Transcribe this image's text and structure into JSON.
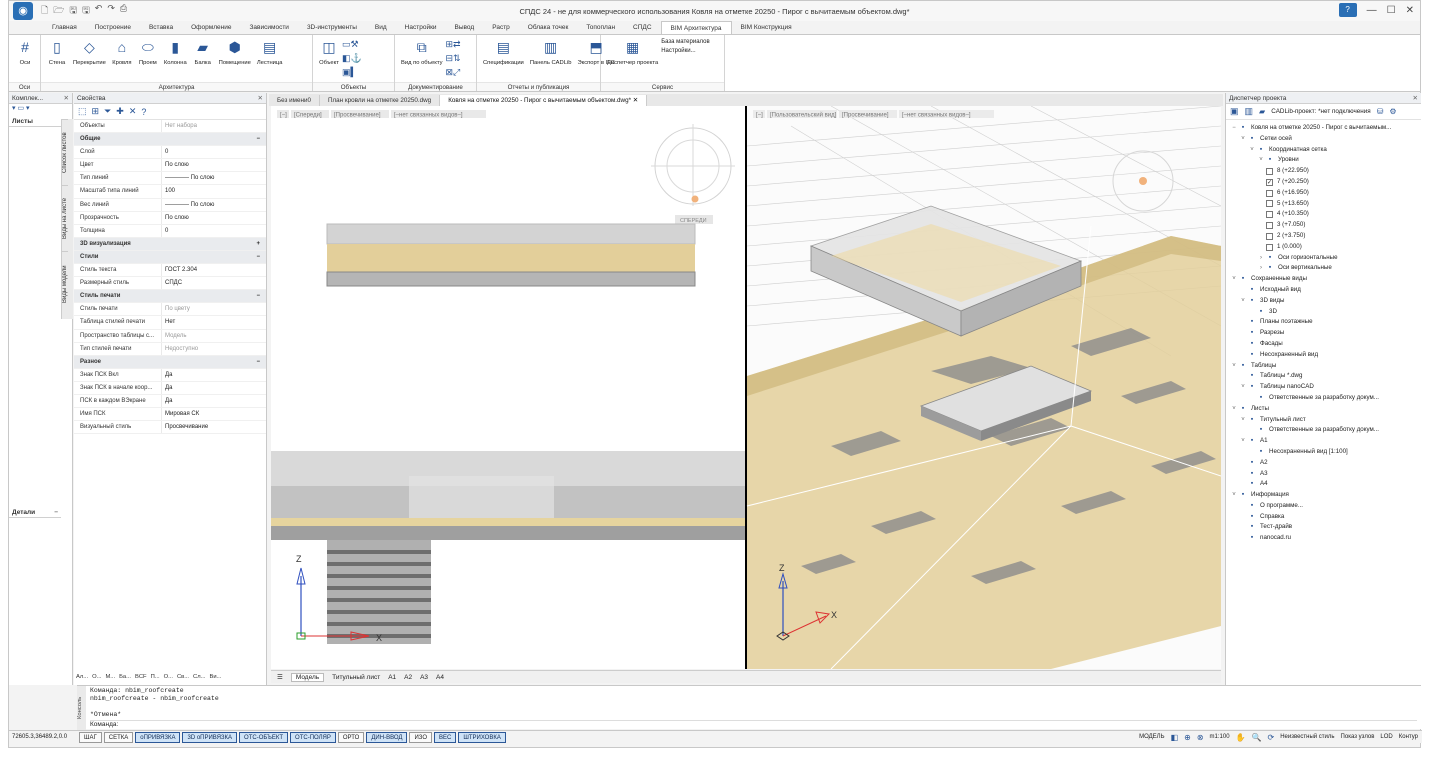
{
  "window": {
    "title": "СПДС 24 - не для коммерческого использования Ковля на отметке 20250 - Пирог с вычитаемым объектом.dwg*",
    "help": "?",
    "controls": [
      "—",
      "☐",
      "✕"
    ]
  },
  "ribbon_tabs": [
    "Главная",
    "Построение",
    "Вставка",
    "Оформление",
    "Зависимости",
    "3D-инструменты",
    "Вид",
    "Настройки",
    "Вывод",
    "Растр",
    "Облака точек",
    "Топоплан",
    "СПДС",
    "BIM Архитектура",
    "BIM Конструкция"
  ],
  "active_tab": "BIM Архитектура",
  "ribbon": {
    "groups": [
      {
        "label": "Оси",
        "buttons": [
          {
            "label": "Оси",
            "icon": "grid-axes-icon"
          }
        ]
      },
      {
        "label": "Архитектура",
        "buttons": [
          {
            "label": "Стена",
            "icon": "wall-icon"
          },
          {
            "label": "Перекрытие",
            "icon": "slab-icon"
          },
          {
            "label": "Кровля",
            "icon": "roof-icon"
          },
          {
            "label": "Проем",
            "icon": "opening-icon"
          },
          {
            "label": "Колонна",
            "icon": "column-icon"
          },
          {
            "label": "Балка",
            "icon": "beam-icon"
          },
          {
            "label": "Помещение",
            "icon": "room-icon"
          },
          {
            "label": "Лестница",
            "icon": "stair-icon"
          }
        ]
      },
      {
        "label": "Объекты",
        "buttons": [
          {
            "label": "Объект",
            "icon": "object-icon"
          }
        ]
      },
      {
        "label": "Документирование",
        "buttons": [
          {
            "label": "Вид по объекту",
            "icon": "view-by-object-icon"
          }
        ]
      },
      {
        "label": "Отчеты и публикация",
        "buttons": [
          {
            "label": "Спецификации",
            "icon": "specification-icon"
          },
          {
            "label": "Панель CADLib",
            "icon": "cadlib-panel-icon"
          },
          {
            "label": "Экспорт в IFC",
            "icon": "ifc-export-icon"
          }
        ]
      },
      {
        "label": "Сервис",
        "buttons": [
          {
            "label": "Диспетчер проекта",
            "icon": "project-manager-icon"
          }
        ],
        "side": [
          "База материалов",
          "Настройки..."
        ]
      }
    ]
  },
  "left_panel": {
    "title": "Комплек...",
    "sheets_label": "Листы",
    "details_label": "Детали",
    "vertical_tabs": [
      "Список листов",
      "Виды на листе",
      "Виды модели"
    ]
  },
  "properties": {
    "title": "Свойства",
    "rows": [
      {
        "k": "Объекты",
        "v": "Нет набора",
        "dim": true
      },
      {
        "section": "Общие",
        "sign": "−"
      },
      {
        "k": "Слой",
        "v": "0"
      },
      {
        "k": "Цвет",
        "v": "По слою"
      },
      {
        "k": "Тип линий",
        "v": "———— По слою"
      },
      {
        "k": "Масштаб типа линий",
        "v": "100"
      },
      {
        "k": "Вес линий",
        "v": "———— По слою"
      },
      {
        "k": "Прозрачность",
        "v": "По слою"
      },
      {
        "k": "Толщина",
        "v": "0"
      },
      {
        "section": "3D визуализация",
        "sign": "+"
      },
      {
        "section": "Стили",
        "sign": "−"
      },
      {
        "k": "Стиль текста",
        "v": "ГОСТ 2.304"
      },
      {
        "k": "Размерный стиль",
        "v": "СПДС"
      },
      {
        "section": "Стиль печати",
        "sign": "−"
      },
      {
        "k": "Стиль печати",
        "v": "По цвету",
        "dim": true
      },
      {
        "k": "Таблица стилей печати",
        "v": "Нет"
      },
      {
        "k": "Пространство таблицы с...",
        "v": "Модель",
        "dim": true
      },
      {
        "k": "Тип стилей печати",
        "v": "Недоступно",
        "dim": true
      },
      {
        "section": "Разное",
        "sign": "−"
      },
      {
        "k": "Знак ПСК Вкл",
        "v": "Да"
      },
      {
        "k": "Знак ПСК в начале коор...",
        "v": "Да"
      },
      {
        "k": "ПСК в каждом ВЭкране",
        "v": "Да"
      },
      {
        "k": "Имя ПСК",
        "v": "Мировая СК"
      },
      {
        "k": "Визуальный стиль",
        "v": "Просвечивание"
      }
    ],
    "bottom_tabs": [
      "Ал...",
      "О...",
      "М...",
      "Ба...",
      "BCF",
      "П...",
      "О...",
      "Св...",
      "Сл...",
      "Ви..."
    ]
  },
  "doc_tabs": [
    "Без имени0",
    "План кровли на отметке 20250.dwg",
    "Ковля на отметке 20250 - Пирог с вычитаемым объектом.dwg*"
  ],
  "doc_tab_close": "✕",
  "viewport": {
    "left_labels": [
      "[−]",
      "[Спереди]",
      "[Просвечивание]",
      "[–нет связанных видов–]"
    ],
    "right_labels": [
      "[−]",
      "[Пользовательский вид]",
      "[Просвечивание]",
      "[–нет связанных видов–]"
    ],
    "front_label": "СПЕРЕДИ"
  },
  "layout_tabs": [
    "Модель",
    "Титульный лист",
    "A1",
    "A2",
    "A3",
    "A4"
  ],
  "active_layout": "Модель",
  "project_manager": {
    "title": "Диспетчер проекта",
    "project_label": "CADLib-проект: *нет подключения",
    "tree": [
      {
        "d": 0,
        "tw": "−",
        "icon": "drawing-icon",
        "label": "Ковля на отметке 20250 - Пирог с вычитаемым..."
      },
      {
        "d": 1,
        "tw": "˅",
        "icon": "grid-icon",
        "label": "Сетки осей"
      },
      {
        "d": 2,
        "tw": "˅",
        "icon": "grid-icon",
        "label": "Координатная сетка"
      },
      {
        "d": 3,
        "tw": "˅",
        "icon": "levels-icon",
        "label": "Уровни"
      },
      {
        "d": 4,
        "cb": "",
        "label": "8 (+22.950)"
      },
      {
        "d": 4,
        "cb": "✓",
        "label": "7 (+20.250)"
      },
      {
        "d": 4,
        "cb": "",
        "label": "6 (+16.950)"
      },
      {
        "d": 4,
        "cb": "",
        "label": "5 (+13.650)"
      },
      {
        "d": 4,
        "cb": "",
        "label": "4 (+10.350)"
      },
      {
        "d": 4,
        "cb": "",
        "label": "3 (+7.050)"
      },
      {
        "d": 4,
        "cb": "",
        "label": "2 (+3.750)"
      },
      {
        "d": 4,
        "cb": "",
        "label": "1 (0.000)"
      },
      {
        "d": 3,
        "tw": "›",
        "icon": "axes-horizontal-icon",
        "label": "Оси горизонтальные"
      },
      {
        "d": 3,
        "tw": "›",
        "icon": "axes-vertical-icon",
        "label": "Оси вертикальные"
      },
      {
        "d": 0,
        "tw": "˅",
        "icon": "saved-views-icon",
        "label": "Сохраненные виды"
      },
      {
        "d": 1,
        "tw": "",
        "icon": "view-icon",
        "label": "Исходный вид"
      },
      {
        "d": 1,
        "tw": "˅",
        "icon": "3d-view-icon",
        "label": "3D виды"
      },
      {
        "d": 2,
        "tw": "",
        "icon": "3d-view-icon",
        "label": "3D"
      },
      {
        "d": 1,
        "tw": "",
        "icon": "floor-plan-icon",
        "label": "Планы поэтажные"
      },
      {
        "d": 1,
        "tw": "",
        "icon": "section-icon",
        "label": "Разрезы"
      },
      {
        "d": 1,
        "tw": "",
        "icon": "facade-icon",
        "label": "Фасады"
      },
      {
        "d": 1,
        "tw": "",
        "icon": "unsaved-view-icon",
        "label": "Несохраненный вид"
      },
      {
        "d": 0,
        "tw": "˅",
        "icon": "tables-icon",
        "label": "Таблицы"
      },
      {
        "d": 1,
        "tw": "",
        "icon": "table-dwg-icon",
        "label": "Таблицы *.dwg"
      },
      {
        "d": 1,
        "tw": "˅",
        "icon": "table-icon",
        "label": "Таблицы nanoCAD"
      },
      {
        "d": 2,
        "tw": "",
        "icon": "table-icon",
        "label": "Ответственные за разработку докум..."
      },
      {
        "d": 0,
        "tw": "˅",
        "icon": "sheets-icon",
        "label": "Листы"
      },
      {
        "d": 1,
        "tw": "˅",
        "icon": "sheet-icon",
        "label": "Титульный лист"
      },
      {
        "d": 2,
        "tw": "",
        "icon": "table-icon",
        "label": "Ответственные за разработку докум..."
      },
      {
        "d": 1,
        "tw": "˅",
        "icon": "sheet-icon",
        "label": "A1"
      },
      {
        "d": 2,
        "tw": "",
        "icon": "view-icon",
        "label": "Несохраненный вид [1:100]"
      },
      {
        "d": 1,
        "tw": "",
        "icon": "sheet-icon",
        "label": "A2"
      },
      {
        "d": 1,
        "tw": "",
        "icon": "sheet-icon",
        "label": "A3"
      },
      {
        "d": 1,
        "tw": "",
        "icon": "sheet-icon",
        "label": "A4"
      },
      {
        "d": 0,
        "tw": "˅",
        "icon": "info-icon",
        "label": "Информация"
      },
      {
        "d": 1,
        "tw": "",
        "icon": "about-icon",
        "label": "О программе..."
      },
      {
        "d": 1,
        "tw": "",
        "icon": "help-icon",
        "label": "Справка"
      },
      {
        "d": 1,
        "tw": "",
        "icon": "test-drive-icon",
        "label": "Тест-драйв"
      },
      {
        "d": 1,
        "tw": "",
        "icon": "web-icon",
        "label": "nanocad.ru"
      }
    ]
  },
  "command_line": {
    "label": "Консоль",
    "lines": [
      "Команда: nbim_roofcreate",
      "nbim_roofcreate - nbim_roofcreate",
      "",
      "*Отмена*"
    ],
    "prompt": "Команда:"
  },
  "status": {
    "coords": "72605.3,36489.2,0.0",
    "toggles": [
      {
        "label": "ШАГ",
        "on": false
      },
      {
        "label": "СЕТКА",
        "on": false
      },
      {
        "label": "оПРИВЯЗКА",
        "on": true
      },
      {
        "label": "3D оПРИВЯЗКА",
        "on": true
      },
      {
        "label": "ОТС-ОБЪЕКТ",
        "on": true
      },
      {
        "label": "ОТС-ПОЛЯР",
        "on": true
      },
      {
        "label": "ОРТО",
        "on": false
      },
      {
        "label": "ДИН-ВВОД",
        "on": true
      },
      {
        "label": "ИЗО",
        "on": false
      },
      {
        "label": "ВЕС",
        "on": true
      },
      {
        "label": "ШТРИХОВКА",
        "on": true
      }
    ],
    "model_label": "МОДЕЛЬ",
    "scale": "m1:100",
    "style_text": "Неизвестный стиль",
    "nodes_text": "Показ узлов",
    "lod_text": "LOD",
    "contour_text": "Контур"
  },
  "colors": {
    "accent": "#2b5797",
    "roof": "#e3cf9a",
    "slab_gray": "#c9c9c9"
  }
}
